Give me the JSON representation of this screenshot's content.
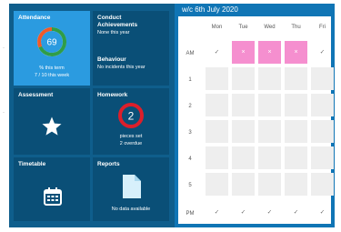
{
  "tiles": {
    "attendance": {
      "title": "Attendance",
      "value": "69",
      "line1": "% this term",
      "line2": "7 / 10 this week"
    },
    "conduct": {
      "title1": "Conduct",
      "title2": "Achievements",
      "achievements_value": "None this year",
      "behaviour_title": "Behaviour",
      "behaviour_value": "No incidents this year"
    },
    "assessment": {
      "title": "Assessment",
      "icon": "star-icon"
    },
    "homework": {
      "title": "Homework",
      "value": "2",
      "line1": "pieces set",
      "line2": "2 overdue"
    },
    "timetable": {
      "title": "Timetable",
      "icon": "calendar-icon"
    },
    "reports": {
      "title": "Reports",
      "icon": "document-icon",
      "value": "No data available"
    }
  },
  "calendar": {
    "header": "w/c 6th July 2020",
    "days": [
      "Mon",
      "Tue",
      "Wed",
      "Thu",
      "Fri"
    ],
    "rows": [
      "AM",
      "1",
      "2",
      "3",
      "4",
      "5",
      "PM"
    ],
    "am_marks": [
      "✓",
      "×",
      "×",
      "×",
      "✓"
    ],
    "pm_marks": [
      "✓",
      "✓",
      "✓",
      "✓",
      "✓"
    ]
  },
  "colors": {
    "frame": "#0f5e8c",
    "tile": "#0a4f77",
    "attendance_tile": "#2b9be0",
    "absent": "#f58fcf",
    "calendar_header": "#1075b5"
  }
}
